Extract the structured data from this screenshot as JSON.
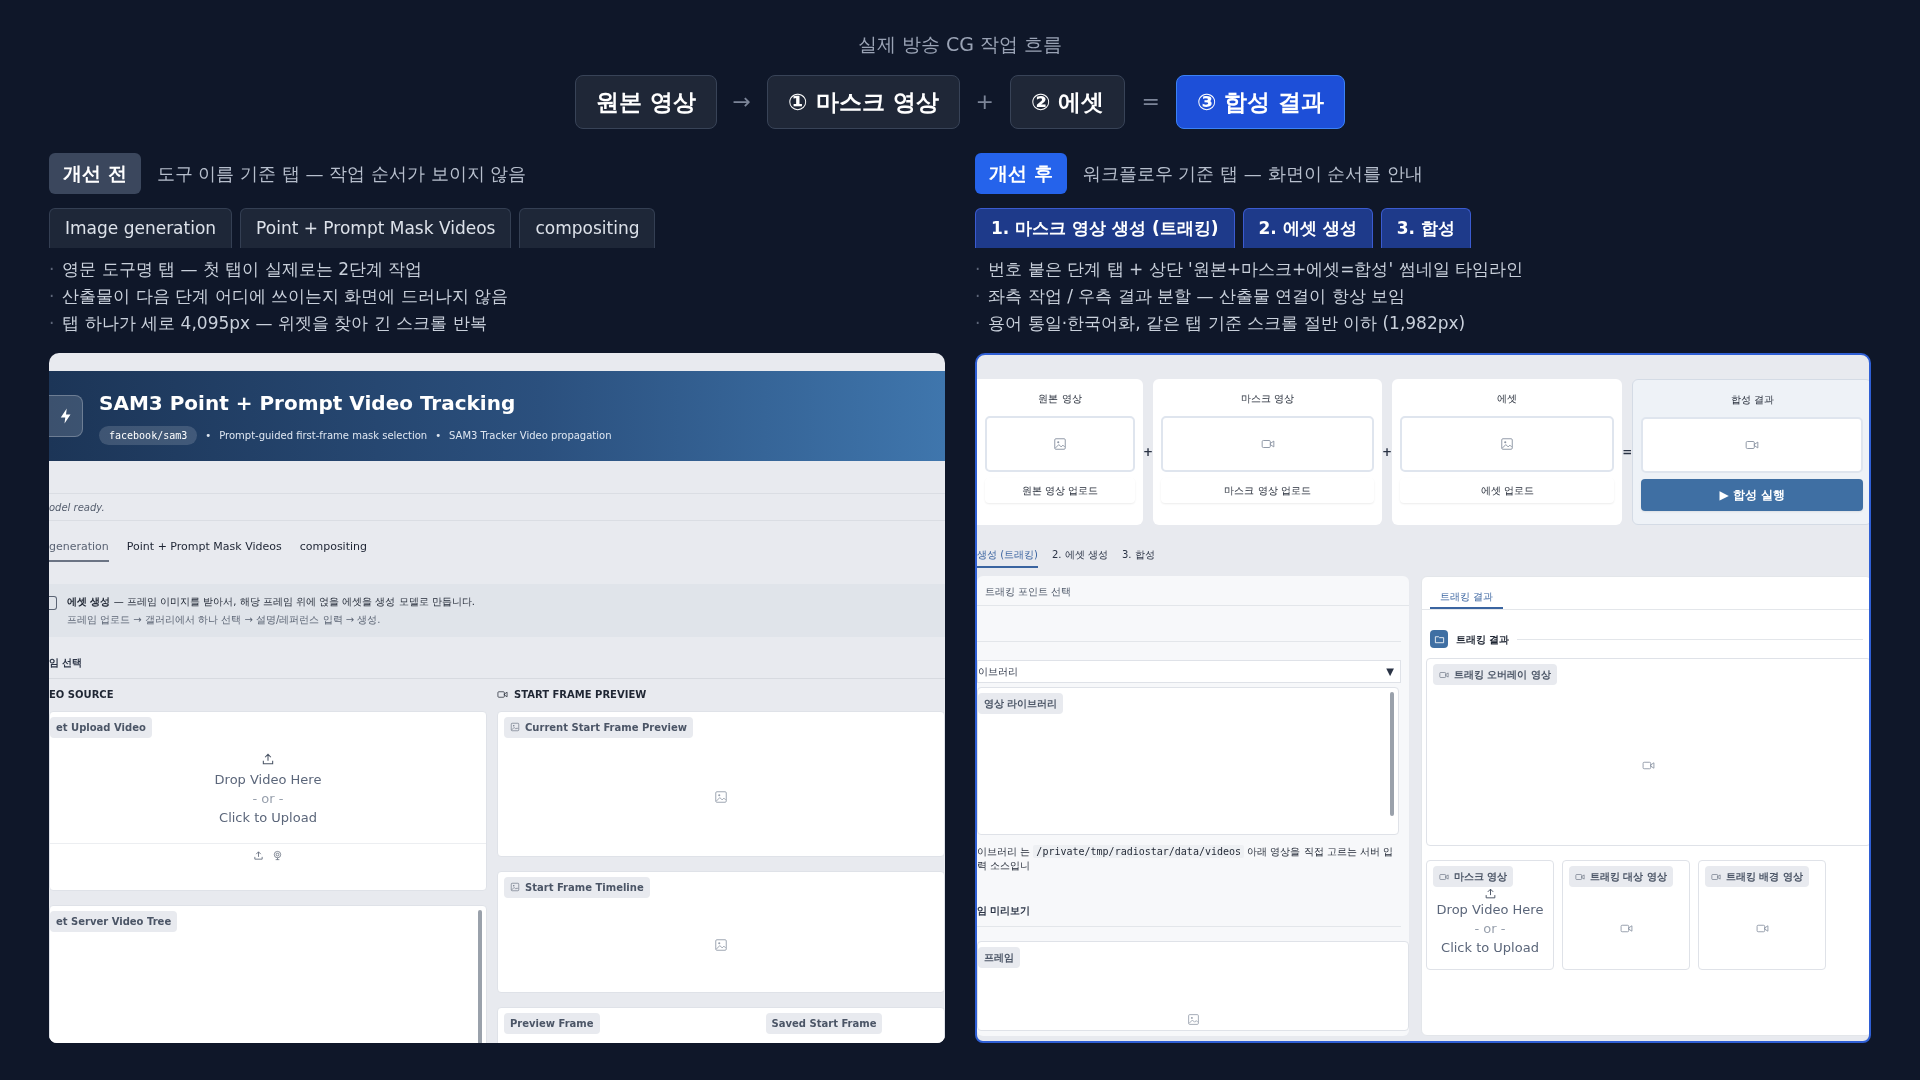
{
  "subtitle": "실제 방송 CG 작업 흐름",
  "flow": [
    {
      "kind": "step",
      "label": "원본 영상",
      "highlighted": false
    },
    {
      "kind": "operator",
      "label": "→"
    },
    {
      "kind": "step",
      "label": "① 마스크 영상",
      "highlighted": false
    },
    {
      "kind": "operator",
      "label": "+"
    },
    {
      "kind": "step",
      "label": "② 에셋",
      "highlighted": false
    },
    {
      "kind": "operator",
      "label": "="
    },
    {
      "kind": "step",
      "label": "③ 합성 결과",
      "highlighted": true
    }
  ],
  "before": {
    "badge": "개선 전",
    "caption": "도구 이름 기준 탭 — 작업 순서가 보이지 않음",
    "tabs": [
      "Image generation",
      "Point + Prompt Mask Videos",
      "compositing"
    ],
    "notes": [
      {
        "bullet": "·",
        "text": "영문 도구명 탭 — 첫 탭이 실제로는 2단계 작업"
      },
      {
        "bullet": "·",
        "text": "산출물이 다음 단계 어디에 쓰이는지 화면에 드러나지 않음"
      },
      {
        "bullet": "·",
        "text": "탭 하나가 세로 4,095px — 위젯을 찾아 긴 스크롤 반복"
      }
    ],
    "screenshot": {
      "banner": {
        "title": "SAM3 Point + Prompt Video Tracking",
        "repo": "facebook/sam3",
        "features": [
          {
            "bullet": "•",
            "text": "Prompt-guided first-frame mask selection"
          },
          {
            "bullet": "•",
            "text": "SAM3 Tracker Video propagation"
          }
        ]
      },
      "status": "odel ready.",
      "tabs": [
        {
          "label": "generation",
          "selected": true
        },
        {
          "label": "Point + Prompt Mask Videos",
          "selected": false
        },
        {
          "label": "compositing",
          "selected": false
        }
      ],
      "info": {
        "text": "**에셋 생성** — 프레임 이미지를 받아서, 해당 프레임 위에 얹을 에셋을 생성 모델로 만듭니다.",
        "hint": "프레임 업로드 → 갤러리에서 하나 선택 → 설명/레퍼런스 입력 → 생성."
      },
      "section_label": "임 선택",
      "source": {
        "heading": "EO SOURCE",
        "upload": {
          "label": "et Upload Video",
          "drop": "Drop Video Here",
          "or": "- or -",
          "click": "Click to Upload"
        },
        "tree": {
          "label": "et Server Video Tree"
        }
      },
      "preview": {
        "heading": "START FRAME PREVIEW",
        "cards": [
          {
            "label": "Current Start Frame Preview"
          },
          {
            "label": "Start Frame Timeline"
          }
        ],
        "frames": [
          "Preview Frame",
          "Saved Start Frame"
        ]
      }
    }
  },
  "after": {
    "badge": "개선 후",
    "caption": "워크플로우 기준 탭 — 화면이 순서를 안내",
    "tabs": [
      "1. 마스크 영상 생성 (트래킹)",
      "2. 에셋 생성",
      "3. 합성"
    ],
    "notes": [
      {
        "bullet": "·",
        "text": "번호 붙은 단계 탭 + 상단 '원본+마스크+에셋=합성' 썸네일 타임라인"
      },
      {
        "bullet": "·",
        "text": "좌측 작업 / 우측 결과 분할 — 산출물 연결이 항상 보임"
      },
      {
        "bullet": "·",
        "text": "용어 통일·한국어화, 같은 탭 기준 스크롤 절반 이하 (1,982px)"
      }
    ],
    "screenshot": {
      "pipeline": [
        {
          "kind": "card",
          "title": "원본 영상",
          "video": false,
          "action": "원본 영상 업로드"
        },
        {
          "kind": "operator",
          "label": "+"
        },
        {
          "kind": "card",
          "title": "마스크 영상",
          "video": true,
          "action": "마스크 영상 업로드"
        },
        {
          "kind": "operator",
          "label": "+"
        },
        {
          "kind": "card",
          "title": "에셋",
          "video": false,
          "action": "에셋 업로드"
        },
        {
          "kind": "operator",
          "label": "="
        },
        {
          "kind": "result",
          "title": "합성 결과",
          "video": true,
          "action": "▶ 합성 실행"
        }
      ],
      "tabs": [
        {
          "label": "생성 (트래킹)",
          "selected": true
        },
        {
          "label": "2. 에셋 생성",
          "selected": false
        },
        {
          "label": "3. 합성",
          "selected": false
        }
      ],
      "left_panel": {
        "title": "트래킹 포인트 선택",
        "dropdown": {
          "value": "이브러리",
          "caret": "▼"
        },
        "library": {
          "label": "영상 라이브러리"
        },
        "note": {
          "before": "이브러리 는",
          "code": "/private/tmp/radiostar/data/videos",
          "after": "아래 영상을 직접 고르는 서버 입력 소스입니"
        },
        "preview_label": "임 미리보기",
        "frame": {
          "label": "프레임"
        }
      },
      "right_panel": {
        "tab": "트래킹 결과",
        "group": "트래킹 결과",
        "overlay": {
          "label": "트래킹 오버레이 영상"
        },
        "outputs": [
          {
            "kind": "upload",
            "label": "마스크 영상",
            "drop": "Drop Video Here",
            "or": "- or -",
            "click": "Click to Upload"
          },
          {
            "kind": "video",
            "label": "트래킹 대상 영상"
          },
          {
            "kind": "video",
            "label": "트래킹 배경 영상"
          }
        ]
      }
    }
  }
}
